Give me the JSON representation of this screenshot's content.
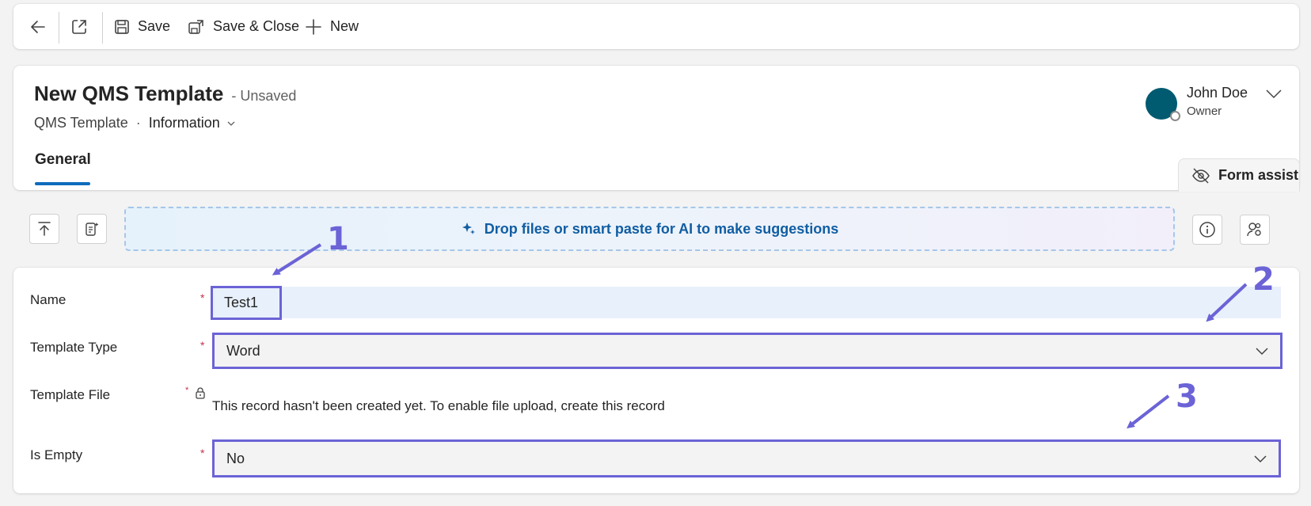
{
  "toolbar": {
    "back_icon": "arrow-left-icon",
    "popout_icon": "open-in-new-window-icon",
    "save_label": "Save",
    "save_close_label": "Save & Close",
    "new_label": "New"
  },
  "header": {
    "title": "New QMS Template",
    "status": "- Unsaved",
    "entity": "QMS Template",
    "separator": "·",
    "form_name": "Information",
    "tab_general": "General",
    "owner_name": "John Doe",
    "owner_role": "Owner",
    "avatar_color": "#005a70",
    "form_assist_label": "Form assist"
  },
  "smart_paste": {
    "dropzone_text": "Drop files or smart paste for AI to make suggestions"
  },
  "form": {
    "fields": {
      "name_label": "Name",
      "name_value": "Test1",
      "type_label": "Template Type",
      "type_value": "Word",
      "file_label": "Template File",
      "file_message": "This record hasn't been created yet. To enable file upload, create this record",
      "empty_label": "Is Empty",
      "empty_value": "No"
    },
    "required_marker": "*"
  },
  "annotations": {
    "one": "1",
    "two": "2",
    "three": "3",
    "color": "#6b63d6"
  },
  "colors": {
    "accent": "#0f6cbd",
    "required": "#c4314b"
  }
}
